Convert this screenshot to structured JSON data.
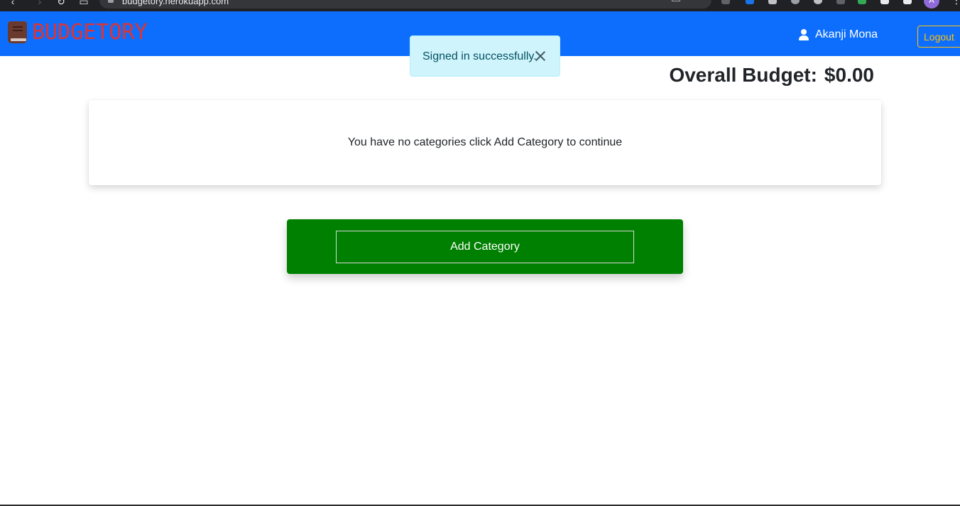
{
  "browser": {
    "url": "budgetory.herokuapp.com",
    "profile_initial": "A"
  },
  "navbar": {
    "brand": "BUDGETORY",
    "brand_color": "#d6363b",
    "bar_color": "#0d6efd",
    "user_name": "Akanji Mona",
    "logout_label": "Logout"
  },
  "toast": {
    "message": "Signed in successfully."
  },
  "summary": {
    "label": "Overall Budget:",
    "amount": "$0.00"
  },
  "categories": {
    "empty_message": "You have no categories click Add Category to continue"
  },
  "actions": {
    "add_category_label": "Add Category",
    "add_category_color": "#008000"
  }
}
